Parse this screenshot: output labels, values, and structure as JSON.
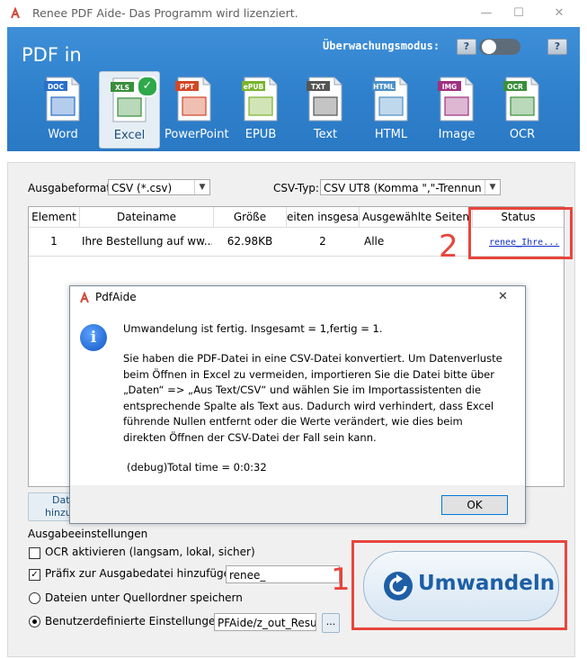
{
  "window": {
    "title": "Renee PDF Aide- Das Programm wird lizenziert.",
    "minimize_glyph": "—",
    "maximize_glyph": "☐",
    "close_glyph": "✕"
  },
  "header": {
    "title": "PDF in",
    "monitor_label": "Überwachungsmodus:",
    "help_glyph": "?",
    "formats": [
      {
        "label": "Word",
        "tag": "DOC",
        "icon": "word-doc-icon",
        "color": "#2a6fc9"
      },
      {
        "label": "Excel",
        "tag": "XLS",
        "icon": "excel-xls-icon",
        "color": "#3a8f3a"
      },
      {
        "label": "PowerPoint",
        "tag": "PPT",
        "icon": "powerpoint-ppt-icon",
        "color": "#d24726"
      },
      {
        "label": "EPUB",
        "tag": "ePUB",
        "icon": "epub-icon",
        "color": "#7ab32e"
      },
      {
        "label": "Text",
        "tag": "TXT",
        "icon": "text-txt-icon",
        "color": "#555555"
      },
      {
        "label": "HTML",
        "tag": "HTML",
        "icon": "html-globe-icon",
        "color": "#4a90c8"
      },
      {
        "label": "Image",
        "tag": "IMG",
        "icon": "image-icon",
        "color": "#a03080"
      },
      {
        "label": "OCR",
        "tag": "OCR",
        "icon": "ocr-icon",
        "color": "#3a8f3a"
      }
    ],
    "active_format": "Excel"
  },
  "options": {
    "output_format_label": "Ausgabeformat:",
    "output_format_value": "CSV (*.csv)",
    "csv_type_label": "CSV-Typ:",
    "csv_type_value": "CSV UT8 (Komma \",\"-Trennun"
  },
  "table": {
    "columns": [
      "Element",
      "Dateiname",
      "Größe",
      "eiten insgesar",
      "Ausgewählte Seiten",
      "Status"
    ],
    "rows": [
      {
        "element": "1",
        "filename": "Ihre Bestellung auf ww...",
        "size": "62.98KB",
        "pages": "2",
        "selected": "Alle",
        "status": "renee_Ihre..."
      }
    ]
  },
  "annotations": {
    "marker_2": "2",
    "marker_1": "1"
  },
  "add_button_partial": [
    "Dat",
    "hinzu"
  ],
  "dialog": {
    "title": "PdfAide",
    "close_glyph": "✕",
    "line1": "Umwandelung ist fertig. Insgesamt = 1,fertig = 1.",
    "paragraph": [
      "Sie haben die PDF-Datei in eine CSV-Datei konvertiert. Um Datenverluste",
      "beim Öffnen in Excel zu vermeiden, importieren Sie die Datei bitte über",
      "„Daten“ => „Aus Text/CSV“ und wählen Sie im Importassistenten die",
      "entsprechende Spalte als Text aus. Dadurch wird verhindert, dass Excel",
      "führende Nullen entfernt oder die Werte verändert, wie dies beim",
      "direkten Öffnen der CSV-Datei der Fall sein kann."
    ],
    "debug": "(debug)Total time = 0:0:32",
    "ok_label": "OK",
    "info_glyph": "i"
  },
  "output_settings": {
    "section_label": "Ausgabeeinstellungen",
    "ocr_label": "OCR aktivieren (langsam, lokal, sicher)",
    "ocr_checked": false,
    "prefix_label": "Präfix zur Ausgabedatei hinzufügen",
    "prefix_checked": true,
    "prefix_value": "renee_",
    "save_source_label": "Dateien unter Quellordner speichern",
    "custom_label": "Benutzerdefinierte Einstellungen",
    "custom_path": "PFAide/z_out_Result",
    "browse_label": "...",
    "selected_option": "custom"
  },
  "convert_button": {
    "label": "Umwandeln",
    "icon": "refresh-icon"
  },
  "colors": {
    "accent_blue": "#2f80cc",
    "annotation_red": "#e8453c",
    "convert_text": "#1d5ea6"
  }
}
